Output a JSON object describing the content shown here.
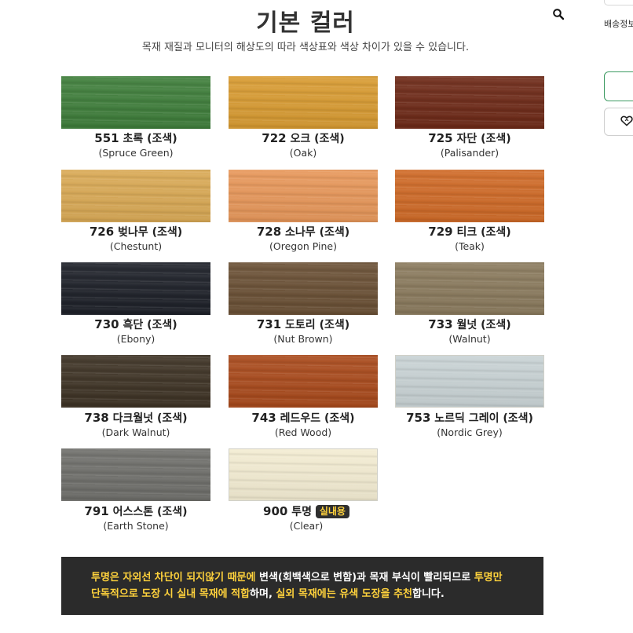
{
  "header": {
    "title": "기본 컬러",
    "subtitle": "목재 재질과 모니터의 해상도의 따라 색상표와 색상 차이가 있을 수 있습니다."
  },
  "side_panel": {
    "shipping_label": "배송정보"
  },
  "icons": [
    "search-icon",
    "heart-icon"
  ],
  "swatches": [
    {
      "code": "551",
      "name": "초록",
      "suffix": "(조색)",
      "english": "(Spruce Green)",
      "color": "#3f7e3b"
    },
    {
      "code": "722",
      "name": "오크",
      "suffix": "(조색)",
      "english": "(Oak)",
      "color": "#d89b32"
    },
    {
      "code": "725",
      "name": "자단",
      "suffix": "(조색)",
      "english": "(Palisander)",
      "color": "#6e2a18"
    },
    {
      "code": "726",
      "name": "벚나무",
      "suffix": "(조색)",
      "english": "(Chestunt)",
      "color": "#d9a955"
    },
    {
      "code": "728",
      "name": "소나무",
      "suffix": "(조색)",
      "english": "(Oregon Pine)",
      "color": "#e7975a"
    },
    {
      "code": "729",
      "name": "티크",
      "suffix": "(조색)",
      "english": "(Teak)",
      "color": "#cf6a27"
    },
    {
      "code": "730",
      "name": "흑단",
      "suffix": "(조색)",
      "english": "(Ebony)",
      "color": "#1e2129"
    },
    {
      "code": "731",
      "name": "도토리",
      "suffix": "(조색)",
      "english": "(Nut Brown)",
      "color": "#6a5035"
    },
    {
      "code": "733",
      "name": "월넛",
      "suffix": "(조색)",
      "english": "(Walnut)",
      "color": "#8a7a5d"
    },
    {
      "code": "738",
      "name": "다크월넛",
      "suffix": "(조색)",
      "english": "(Dark Walnut)",
      "color": "#3e3325"
    },
    {
      "code": "743",
      "name": "레드우드",
      "suffix": "(조색)",
      "english": "(Red Wood)",
      "color": "#a94a1c"
    },
    {
      "code": "753",
      "name": "노르딕 그레이",
      "suffix": "(조색)",
      "english": "(Nordic Grey)",
      "color": "#c8d2d4"
    },
    {
      "code": "791",
      "name": "어스스톤",
      "suffix": "(조색)",
      "english": "(Earth Stone)",
      "color": "#6f6f6b"
    },
    {
      "code": "900",
      "name": "투명",
      "suffix": "",
      "badge": "실내용",
      "english": "(Clear)",
      "color": "#f3ecd2"
    }
  ],
  "notice": {
    "p1": "투명은 자외선 차단이 되지않기 때문에",
    "p2": " 변색(회백색으로 변함)과 목재 부식이 빨리되므로 ",
    "p3": "투명만",
    "p4": "단독적으로 도장 시 실내 목재에 적합",
    "p5": "하며, ",
    "p6": "실외 목재에는 유색 도장을 추천",
    "p7": "합니다.",
    "highlight_color": "#ffd23c"
  }
}
